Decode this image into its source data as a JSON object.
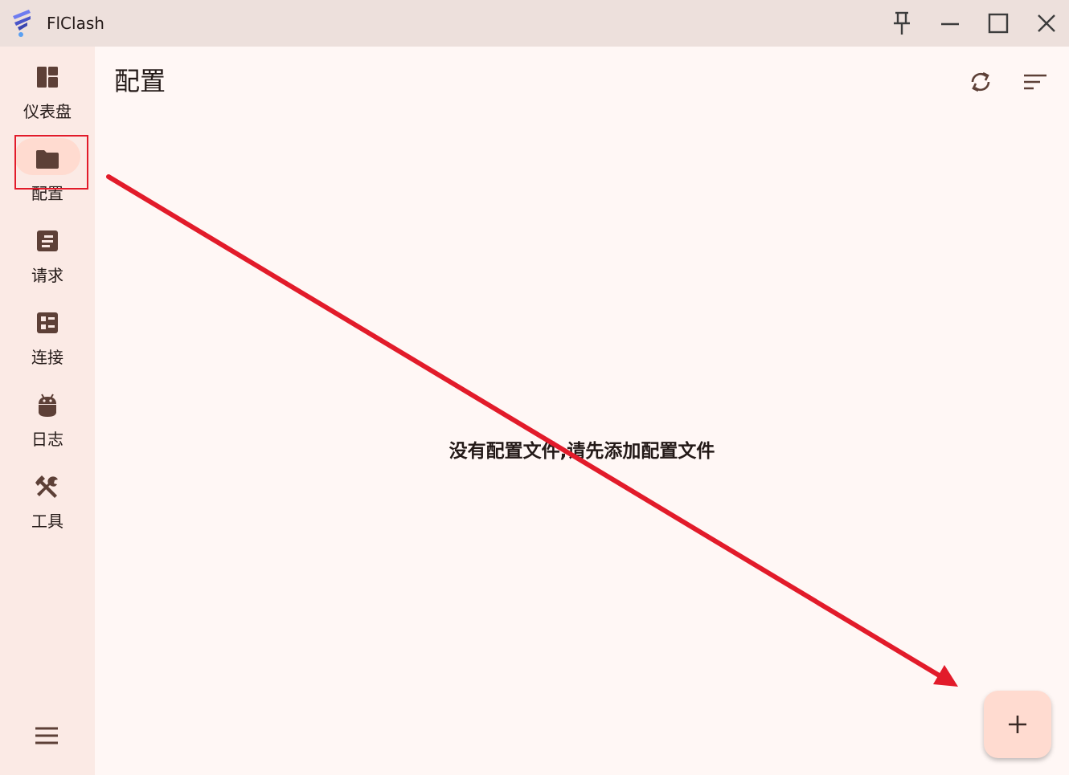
{
  "titlebar": {
    "app_name": "FlClash",
    "logo_icon": "flclash-logo-icon",
    "buttons": [
      {
        "name": "pin-icon"
      },
      {
        "name": "minimize-icon"
      },
      {
        "name": "maximize-icon"
      },
      {
        "name": "close-icon"
      }
    ]
  },
  "sidebar": {
    "items": [
      {
        "label": "仪表盘",
        "icon": "dashboard-icon",
        "active": false
      },
      {
        "label": "配置",
        "icon": "folder-icon",
        "active": true
      },
      {
        "label": "请求",
        "icon": "requests-icon",
        "active": false
      },
      {
        "label": "连接",
        "icon": "connections-icon",
        "active": false
      },
      {
        "label": "日志",
        "icon": "android-icon",
        "active": false
      },
      {
        "label": "工具",
        "icon": "tools-icon",
        "active": false
      }
    ],
    "menu_icon": "menu-icon"
  },
  "main": {
    "title": "配置",
    "empty_message": "没有配置文件,请先添加配置文件",
    "actions": [
      {
        "name": "sync-icon"
      },
      {
        "name": "sort-icon"
      }
    ],
    "fab_icon": "add-icon"
  },
  "colors": {
    "titlebar_bg": "#ede0dc",
    "sidebar_bg": "#fbeae5",
    "content_bg": "#fff7f5",
    "active_pill": "#ffdbd0",
    "icon_color": "#5d4037",
    "annotation_red": "#e21b2a"
  }
}
